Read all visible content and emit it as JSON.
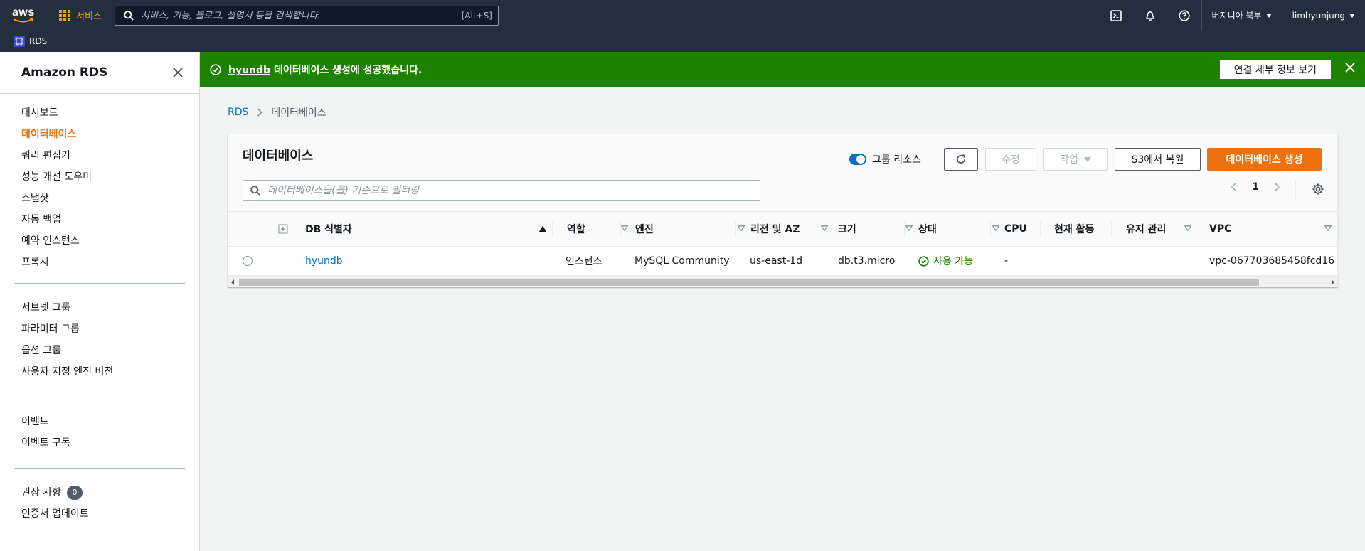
{
  "topnav": {
    "logo_text": "aws",
    "services_label": "서비스",
    "search_placeholder": "서비스, 기능, 블로그, 설명서 등을 검색합니다.",
    "search_shortcut": "[Alt+S]",
    "region_label": "버지니아 북부",
    "user_label": "limhyunjung",
    "service_breadcrumb": "RDS"
  },
  "sidebar": {
    "title": "Amazon RDS",
    "group1": [
      {
        "label": "대시보드"
      },
      {
        "label": "데이터베이스"
      },
      {
        "label": "쿼리 편집기"
      },
      {
        "label": "성능 개선 도우미"
      },
      {
        "label": "스냅샷"
      },
      {
        "label": "자동 백업"
      },
      {
        "label": "예약 인스턴스"
      },
      {
        "label": "프록시"
      }
    ],
    "group2": [
      {
        "label": "서브넷 그룹"
      },
      {
        "label": "파라미터 그룹"
      },
      {
        "label": "옵션 그룹"
      },
      {
        "label": "사용자 지정 엔진 버전"
      }
    ],
    "group3": [
      {
        "label": "이벤트"
      },
      {
        "label": "이벤트 구독"
      }
    ],
    "group4": [
      {
        "label": "권장 사항",
        "badge": "0"
      },
      {
        "label": "인증서 업데이트"
      }
    ],
    "active_item": "데이터베이스"
  },
  "flash": {
    "db_link": "hyundb",
    "message": " 데이터베이스 생성에 성공했습니다.",
    "button_label": "연결 세부 정보 보기",
    "type_color": "#1d8102"
  },
  "breadcrumb": {
    "root": "RDS",
    "current": "데이터베이스"
  },
  "panel": {
    "title": "데이터베이스",
    "group_toggle_label": "그룹 리소스",
    "group_toggle_on": true,
    "modify_label": "수정",
    "actions_label": "작업",
    "restore_label": "S3에서 복원",
    "create_label": "데이터베이스 생성",
    "filter_placeholder": "데이터베이스을(를) 기준으로 필터링",
    "page_number": "1",
    "accent_color": "#ec7211"
  },
  "table": {
    "columns": [
      {
        "label": "DB 식별자"
      },
      {
        "label": "역할"
      },
      {
        "label": "엔진"
      },
      {
        "label": "리전 및 AZ"
      },
      {
        "label": "크기"
      },
      {
        "label": "상태"
      },
      {
        "label": "CPU"
      },
      {
        "label": "현재 활동"
      },
      {
        "label": "유지 관리"
      },
      {
        "label": "VPC"
      }
    ],
    "rows": [
      {
        "identifier": "hyundb",
        "role": "인스턴스",
        "engine": "MySQL Community",
        "region_az": "us-east-1d",
        "size": "db.t3.micro",
        "status": "사용 가능",
        "cpu": "-",
        "activity": "",
        "maintenance": "",
        "vpc": "vpc-067703685458fcd16"
      }
    ]
  }
}
